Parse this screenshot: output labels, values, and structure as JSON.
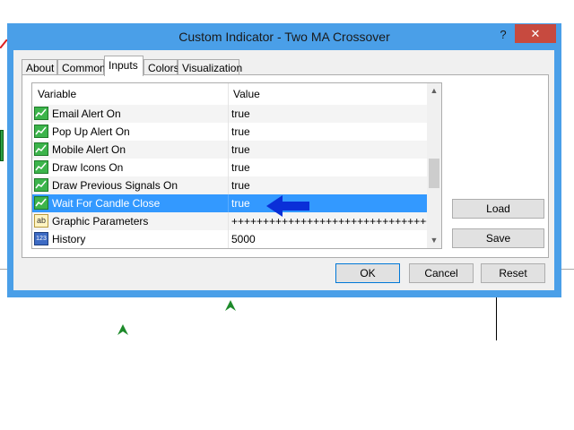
{
  "window": {
    "title": "Custom Indicator - Two MA Crossover",
    "help": "?",
    "close": "✕"
  },
  "tabs": [
    {
      "label": "About",
      "active": false
    },
    {
      "label": "Common",
      "active": false
    },
    {
      "label": "Inputs",
      "active": true
    },
    {
      "label": "Colors",
      "active": false
    },
    {
      "label": "Visualization",
      "active": false
    }
  ],
  "grid": {
    "headers": {
      "variable": "Variable",
      "value": "Value"
    },
    "rows": [
      {
        "icon": "alert-input-icon",
        "variable": "Email Alert On",
        "value": "true"
      },
      {
        "icon": "alert-input-icon",
        "variable": "Pop Up Alert On",
        "value": "true"
      },
      {
        "icon": "alert-input-icon",
        "variable": "Mobile Alert On",
        "value": "true"
      },
      {
        "icon": "alert-input-icon",
        "variable": "Draw Icons On",
        "value": "true"
      },
      {
        "icon": "alert-input-icon",
        "variable": "Draw Previous Signals On",
        "value": "true"
      },
      {
        "icon": "alert-input-icon",
        "variable": "Wait For Candle Close",
        "value": "true",
        "selected": true
      },
      {
        "icon": "string-input-icon",
        "variable": "Graphic Parameters",
        "value": "++++++++++++++++++++++++++++++++++++"
      },
      {
        "icon": "integer-input-icon",
        "variable": "History",
        "value": "5000"
      }
    ],
    "scroll_up": "▲",
    "scroll_down": "▼"
  },
  "side_buttons": {
    "load": "Load",
    "save": "Save"
  },
  "bottom_buttons": {
    "ok": "OK",
    "cancel": "Cancel",
    "reset": "Reset"
  },
  "icon_text": {
    "string": "ab",
    "integer": "123"
  },
  "colors": {
    "selection": "#3399ff",
    "window_border": "#4a9fe8",
    "close_button": "#c74a3f",
    "annotation_arrow": "#0a2fd8"
  }
}
